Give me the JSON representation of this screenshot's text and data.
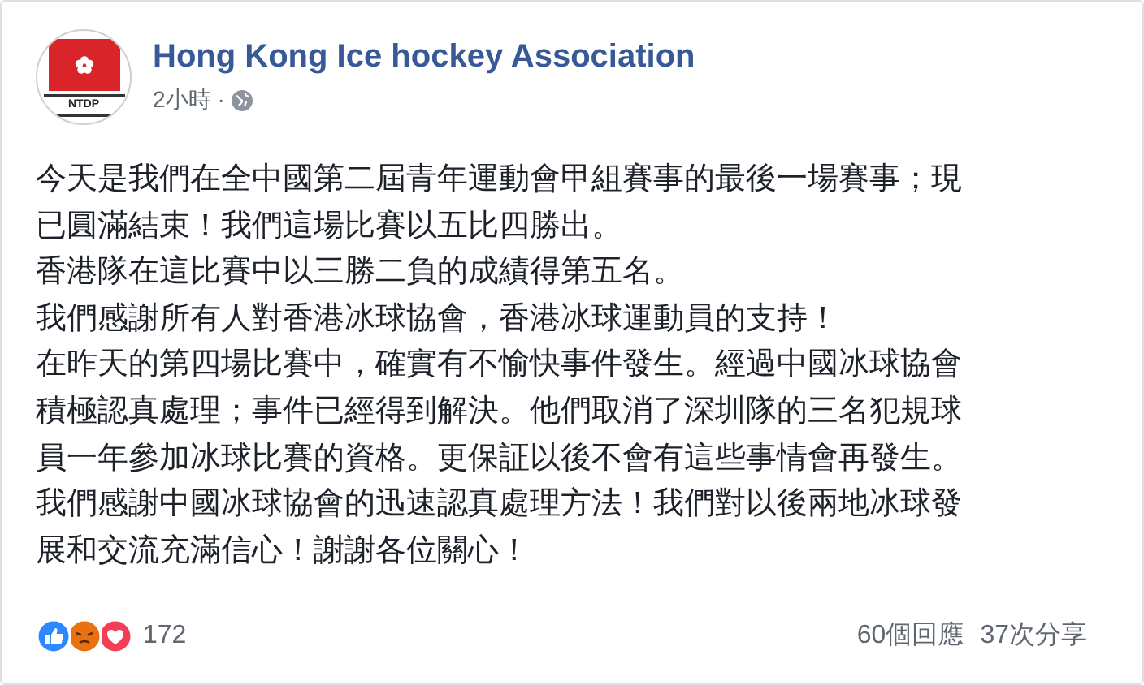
{
  "post": {
    "author": "Hong Kong Ice hockey Association",
    "avatar_label": "NTDP",
    "time": "2小時",
    "separator": "·",
    "lines": [
      "今天是我們在全中國第二屆青年運動會甲組賽事的最後一場賽事；現",
      "已圓滿結束！我們這場比賽以五比四勝出。",
      "香港隊在這比賽中以三勝二負的成績得第五名。",
      "我們感謝所有人對香港冰球協會，香港冰球運動員的支持！",
      "在昨天的第四場比賽中，確實有不愉快事件發生。經過中國冰球協會",
      "積極認真處理；事件已經得到解決。他們取消了深圳隊的三名犯規球",
      "員一年參加冰球比賽的資格。更保証以後不會有這些事情會再發生。",
      "我們感謝中國冰球協會的迅速認真處理方法！我們對以後兩地冰球發",
      "展和交流充滿信心！謝謝各位關心！"
    ]
  },
  "footer": {
    "reactions": [
      {
        "kind": "like"
      },
      {
        "kind": "angry"
      },
      {
        "kind": "love"
      }
    ],
    "reaction_count": "172",
    "comments": "60個回應",
    "shares": "37次分享"
  }
}
